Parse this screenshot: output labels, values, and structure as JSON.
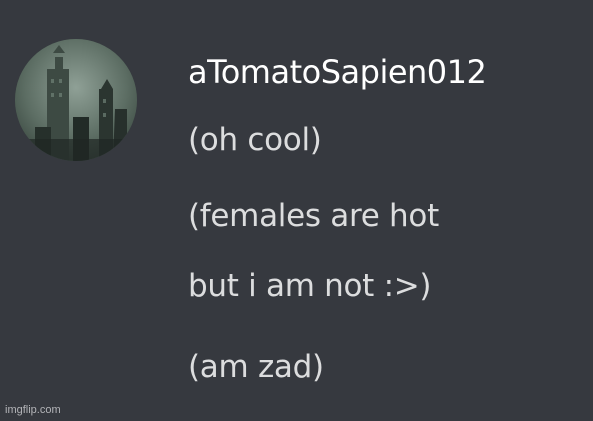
{
  "message": {
    "author": "aTomatoSapien012",
    "lines": [
      "(oh cool)",
      "(females are hot",
      "but i am not :>)",
      "(am zad)"
    ]
  },
  "watermark": "imgflip.com",
  "colors": {
    "background": "#36393f",
    "username": "#ffffff",
    "message_text": "#dcddde"
  }
}
